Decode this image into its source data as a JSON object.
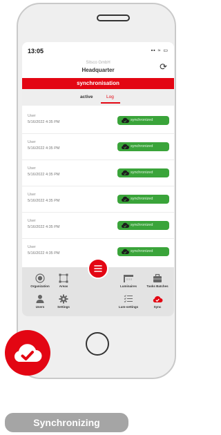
{
  "status": {
    "time": "13:05",
    "icons": "▪▪ ≈ ▭"
  },
  "header": {
    "company": "Sitsco GmbH",
    "location": "Headquarter",
    "title": "synchronisation"
  },
  "tabs": [
    {
      "label": "active"
    },
    {
      "label": "Log"
    }
  ],
  "log_rows": [
    {
      "user": "User",
      "date": "5/16/2022 4:35 PM",
      "status": "synchronized"
    },
    {
      "user": "User",
      "date": "5/16/2022 4:35 PM",
      "status": "synchronized"
    },
    {
      "user": "User",
      "date": "5/16/2022 4:35 PM",
      "status": "synchronized"
    },
    {
      "user": "User",
      "date": "5/16/2022 4:35 PM",
      "status": "synchronized"
    },
    {
      "user": "User",
      "date": "5/16/2022 4:35 PM",
      "status": "synchronized"
    },
    {
      "user": "User",
      "date": "5/16/2022 4:35 PM",
      "status": "synchronized"
    }
  ],
  "nav": {
    "organization": "Organization",
    "areas": "Areas",
    "luminaires": "Luminaires",
    "tasks_batches": "Tasks Batches",
    "users": "Users",
    "settings": "Settings",
    "lum_settings": "Lum-settings",
    "sync": "Sync"
  },
  "caption": "Synchronizing",
  "colors": {
    "accent": "#e30613",
    "success": "#3aa43a"
  }
}
